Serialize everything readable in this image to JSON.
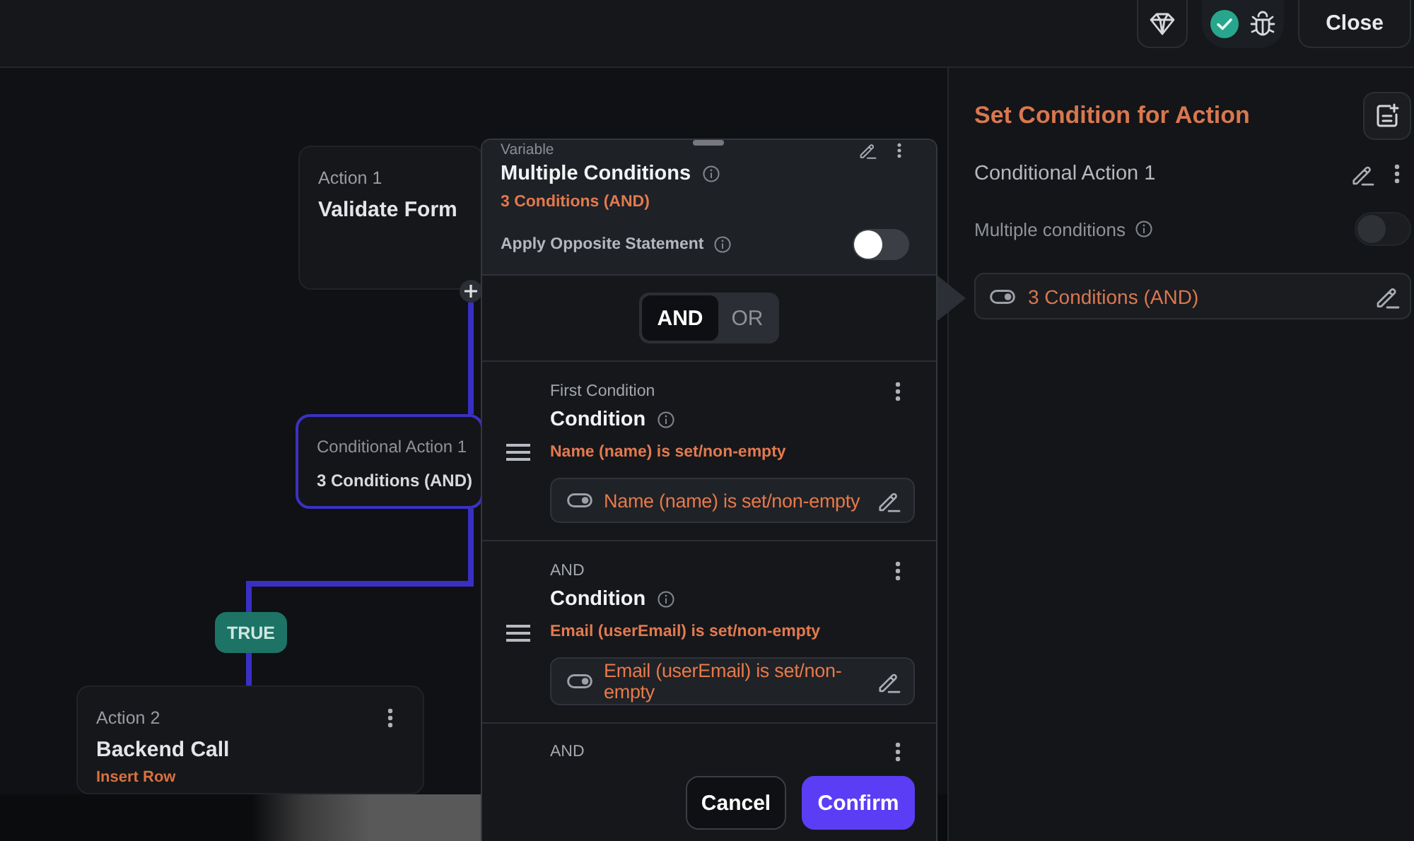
{
  "top_bar": {
    "close_button": "Close"
  },
  "canvas": {
    "nodes": [
      {
        "kind": "action",
        "label": "Action 1",
        "title": "Validate Form",
        "selected": false
      },
      {
        "kind": "condition",
        "label": "Conditional Action 1",
        "title": "3 Conditions (AND)",
        "selected": true
      },
      {
        "kind": "action",
        "label": "Action 2",
        "title": "Backend Call",
        "subtitle": "Insert Row",
        "selected": false
      }
    ],
    "branch_label": "TRUE"
  },
  "condition_popup": {
    "section_label": "Variable",
    "title": "Multiple Conditions",
    "summary": "3 Conditions (AND)",
    "opposite_statement": {
      "label": "Apply Opposite Statement",
      "on": false
    },
    "operators": [
      {
        "label": "AND",
        "selected": true
      },
      {
        "label": "OR",
        "selected": false
      }
    ],
    "conditions": [
      {
        "prefix": "First Condition",
        "title": "Condition",
        "description": "Name (name) is set/non-empty",
        "value": "Name (name) is set/non-empty"
      },
      {
        "prefix": "AND",
        "title": "Condition",
        "description": "Email (userEmail) is set/non-empty",
        "value": "Email (userEmail) is set/non-empty"
      },
      {
        "prefix": "AND"
      }
    ],
    "buttons": [
      {
        "label": "Cancel",
        "kind": "secondary"
      },
      {
        "label": "Confirm",
        "kind": "primary"
      }
    ]
  },
  "side_panel": {
    "title": "Set Condition for Action",
    "action_name": "Conditional Action 1",
    "multiple_conditions": {
      "label": "Multiple conditions",
      "on": false
    },
    "condition_value": "3 Conditions (AND)"
  }
}
